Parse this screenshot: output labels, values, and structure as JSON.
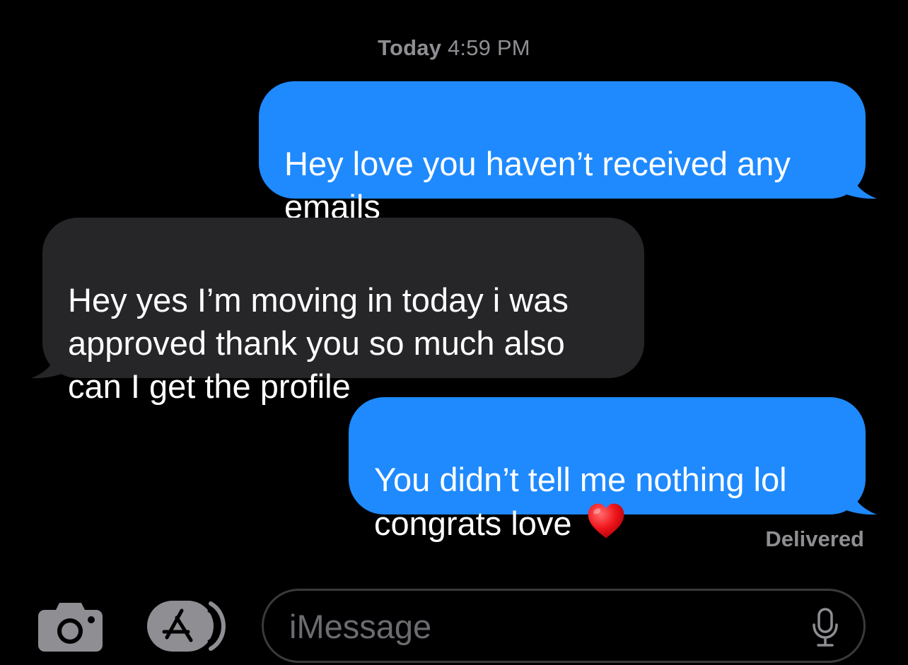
{
  "header": {
    "timestamp_day": "Today",
    "timestamp_time": "4:59 PM"
  },
  "messages": [
    {
      "direction": "outgoing",
      "text": "Hey love you haven’t received any\nemails"
    },
    {
      "direction": "incoming",
      "text": "Hey yes I’m moving in today i was\napproved thank you so much also\ncan I get the profile"
    },
    {
      "direction": "outgoing",
      "text": "You didn’t tell me nothing lol\ncongrats love ",
      "emoji": "red-heart-icon"
    }
  ],
  "status": {
    "delivered_label": "Delivered"
  },
  "composer": {
    "placeholder": "iMessage",
    "value": "",
    "camera_icon": "camera-icon",
    "apps_icon": "app-store-icon",
    "mic_icon": "microphone-icon"
  },
  "colors": {
    "outgoing_bubble": "#1f8afe",
    "incoming_bubble": "#262629",
    "background": "#000000",
    "secondary_text": "#8e8e93"
  }
}
